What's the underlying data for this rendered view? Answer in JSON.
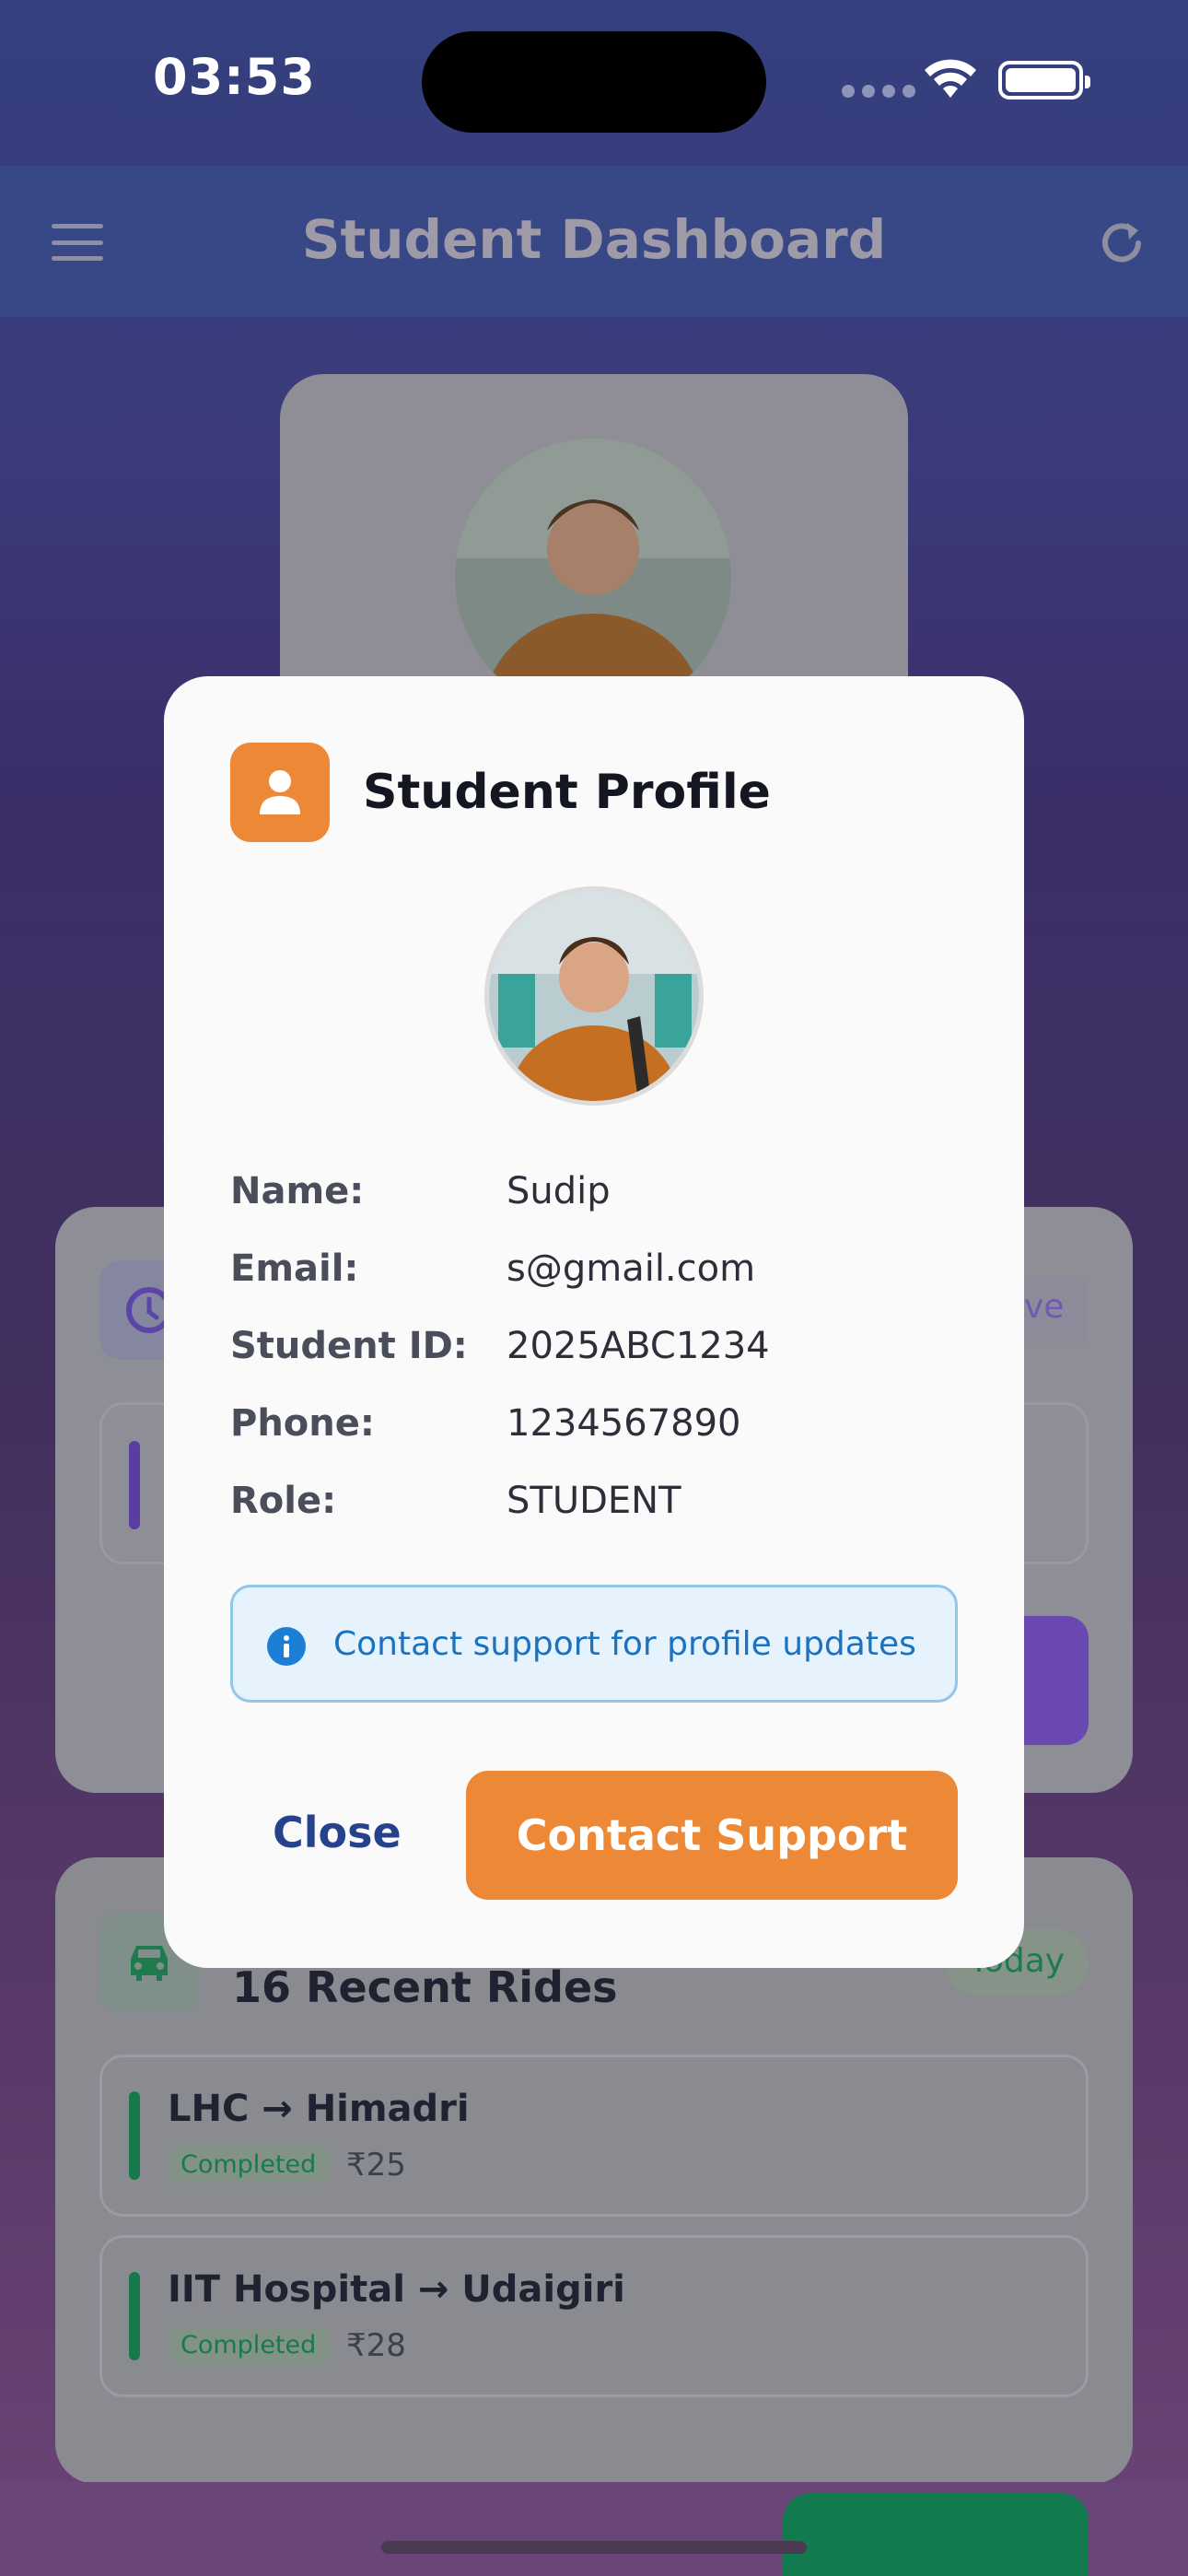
{
  "status_bar": {
    "time": "03:53"
  },
  "app_bar": {
    "title": "Student Dashboard"
  },
  "background": {
    "active_pill": "ve",
    "today_pill": "Today",
    "rides_title": "16 Recent Rides",
    "rides": [
      {
        "route": "LHC → Himadri",
        "status": "Completed",
        "fare": "₹25"
      },
      {
        "route": "IIT Hospital → Udaigiri",
        "status": "Completed",
        "fare": "₹28"
      }
    ]
  },
  "modal": {
    "title": "Student Profile",
    "fields": [
      {
        "label": "Name:",
        "value": "Sudip"
      },
      {
        "label": "Email:",
        "value": "s@gmail.com"
      },
      {
        "label": "Student ID:",
        "value": "2025ABC1234"
      },
      {
        "label": "Phone:",
        "value": "1234567890"
      },
      {
        "label": "Role:",
        "value": "STUDENT"
      }
    ],
    "info": "Contact support for profile updates",
    "close_label": "Close",
    "support_label": "Contact Support"
  },
  "colors": {
    "accent_orange": "#ed8936",
    "primary_blue": "#27428c",
    "success_green": "#177a4c",
    "info_blue": "#1d7ed6"
  }
}
